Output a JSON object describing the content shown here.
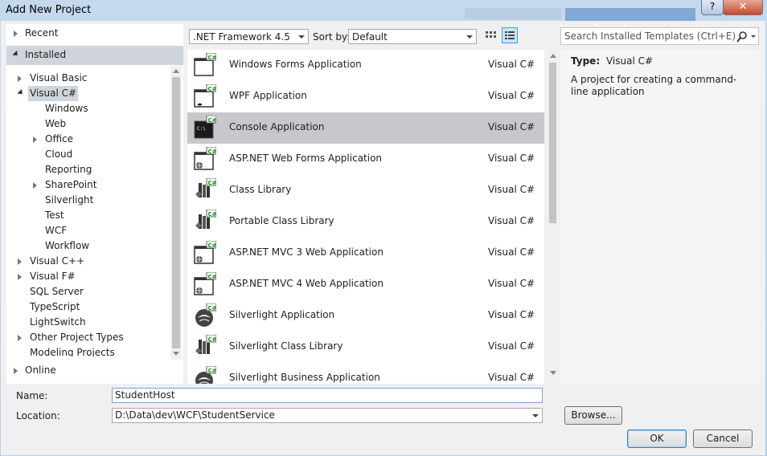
{
  "window": {
    "title": "Add New Project",
    "help_label": "?",
    "close_label": "✕"
  },
  "left_nav": {
    "recent": "Recent",
    "installed": "Installed",
    "online": "Online",
    "tree": [
      {
        "label": "Visual Basic",
        "level": 1,
        "expander": "collapsed"
      },
      {
        "label": "Visual C#",
        "level": 1,
        "expander": "expanded",
        "selected": true
      },
      {
        "label": "Windows",
        "level": 2,
        "expander": "none"
      },
      {
        "label": "Web",
        "level": 2,
        "expander": "none"
      },
      {
        "label": "Office",
        "level": 2,
        "expander": "collapsed"
      },
      {
        "label": "Cloud",
        "level": 2,
        "expander": "none"
      },
      {
        "label": "Reporting",
        "level": 2,
        "expander": "none"
      },
      {
        "label": "SharePoint",
        "level": 2,
        "expander": "collapsed"
      },
      {
        "label": "Silverlight",
        "level": 2,
        "expander": "none"
      },
      {
        "label": "Test",
        "level": 2,
        "expander": "none"
      },
      {
        "label": "WCF",
        "level": 2,
        "expander": "none"
      },
      {
        "label": "Workflow",
        "level": 2,
        "expander": "none"
      },
      {
        "label": "Visual C++",
        "level": 1,
        "expander": "collapsed"
      },
      {
        "label": "Visual F#",
        "level": 1,
        "expander": "collapsed"
      },
      {
        "label": "SQL Server",
        "level": 1,
        "expander": "none"
      },
      {
        "label": "TypeScript",
        "level": 1,
        "expander": "none"
      },
      {
        "label": "LightSwitch",
        "level": 1,
        "expander": "none"
      },
      {
        "label": "Other Project Types",
        "level": 1,
        "expander": "collapsed"
      },
      {
        "label": "Modeling Projects",
        "level": 1,
        "expander": "none"
      }
    ]
  },
  "toolbar": {
    "framework": ".NET Framework 4.5",
    "sort_label": "Sort by:",
    "sort_value": "Default",
    "search_placeholder": "Search Installed Templates (Ctrl+E)"
  },
  "templates": [
    {
      "name": "Windows Forms Application",
      "lang": "Visual C#",
      "icon": "windows-forms-icon"
    },
    {
      "name": "WPF Application",
      "lang": "Visual C#",
      "icon": "wpf-icon"
    },
    {
      "name": "Console Application",
      "lang": "Visual C#",
      "icon": "console-icon",
      "selected": true
    },
    {
      "name": "ASP.NET Web Forms Application",
      "lang": "Visual C#",
      "icon": "web-forms-icon"
    },
    {
      "name": "Class Library",
      "lang": "Visual C#",
      "icon": "class-library-icon"
    },
    {
      "name": "Portable Class Library",
      "lang": "Visual C#",
      "icon": "portable-library-icon"
    },
    {
      "name": "ASP.NET MVC 3 Web Application",
      "lang": "Visual C#",
      "icon": "mvc-icon"
    },
    {
      "name": "ASP.NET MVC 4 Web Application",
      "lang": "Visual C#",
      "icon": "mvc-icon"
    },
    {
      "name": "Silverlight Application",
      "lang": "Visual C#",
      "icon": "silverlight-icon"
    },
    {
      "name": "Silverlight Class Library",
      "lang": "Visual C#",
      "icon": "silverlight-library-icon"
    },
    {
      "name": "Silverlight Business Application",
      "lang": "Visual C#",
      "icon": "silverlight-icon"
    }
  ],
  "details": {
    "type_label": "Type:",
    "type_value": "Visual C#",
    "description": "A project for creating a command-line application"
  },
  "form": {
    "name_label": "Name:",
    "name_value": "StudentHost",
    "location_label": "Location:",
    "location_value": "D:\\Data\\dev\\WCF\\StudentService",
    "browse_label": "Browse...",
    "ok_label": "OK",
    "cancel_label": "Cancel"
  },
  "icon_badge": "C#"
}
